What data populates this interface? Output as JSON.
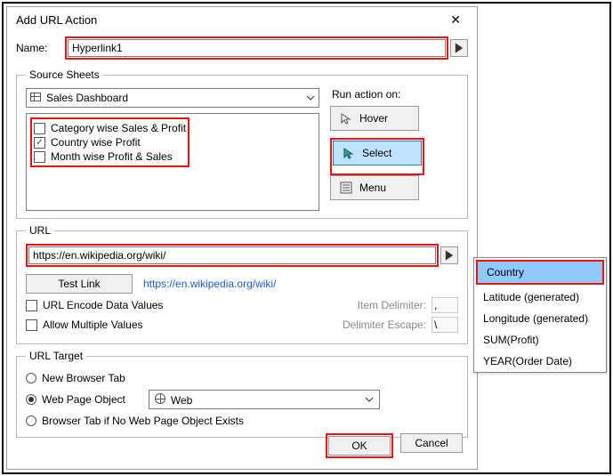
{
  "dialog": {
    "title": "Add URL Action"
  },
  "name": {
    "label": "Name:",
    "value": "Hyperlink1"
  },
  "source_sheets": {
    "legend": "Source Sheets",
    "selected_dashboard": "Sales Dashboard",
    "items": [
      {
        "label": "Category wise Sales & Profit",
        "checked": false
      },
      {
        "label": "Country wise Profit",
        "checked": true
      },
      {
        "label": "Month wise Profit & Sales",
        "checked": false
      }
    ]
  },
  "run_on": {
    "label": "Run action on:",
    "hover": "Hover",
    "select": "Select",
    "menu": "Menu"
  },
  "url": {
    "legend": "URL",
    "value": "https://en.wikipedia.org/wiki/",
    "test_link": "Test Link",
    "preview": "https://en.wikipedia.org/wiki/",
    "encode": "URL Encode Data Values",
    "multi": "Allow Multiple Values",
    "item_delim": "Item Delimiter:",
    "delim_esc": "Delimiter Escape:",
    "item_delim_val": ",",
    "delim_esc_val": "\\"
  },
  "target": {
    "legend": "URL Target",
    "new_tab": "New Browser Tab",
    "web_obj": "Web Page Object",
    "browser_if_no": "Browser Tab if No Web Page Object Exists",
    "web_value": "Web"
  },
  "buttons": {
    "ok": "OK",
    "cancel": "Cancel"
  },
  "popup": {
    "items": [
      "Country",
      "Latitude (generated)",
      "Longitude (generated)",
      "SUM(Profit)",
      "YEAR(Order Date)"
    ]
  }
}
